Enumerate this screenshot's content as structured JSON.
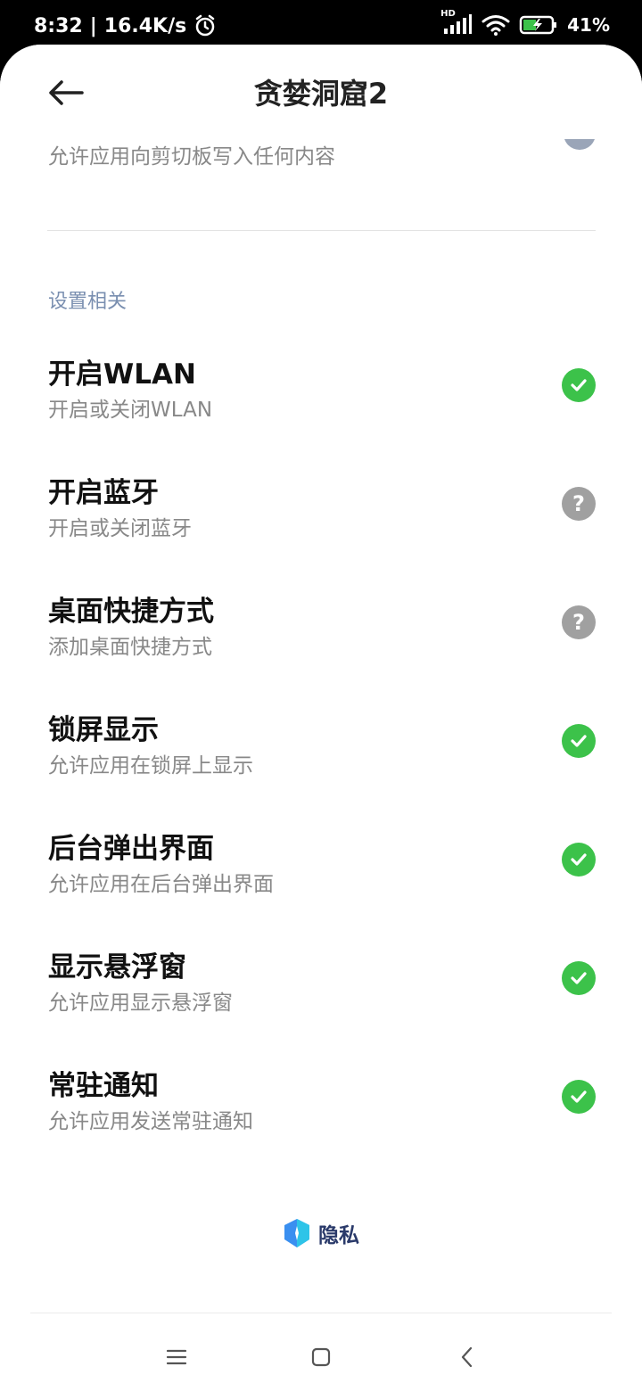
{
  "status_bar": {
    "time": "8:32",
    "separator": "|",
    "net_speed": "16.4K/s",
    "network_badge": "HD",
    "battery": "41%",
    "icons": [
      "alarm-icon",
      "signal-icon",
      "wifi-icon",
      "battery-charging-icon"
    ]
  },
  "header": {
    "title": "贪婪洞窟2",
    "back_icon": "arrow-left-icon"
  },
  "partial_row": {
    "subtitle": "允许应用向剪切板写入任何内容"
  },
  "section": {
    "title": "设置相关"
  },
  "permissions": [
    {
      "title": "开启WLAN",
      "subtitle": "开启或关闭WLAN",
      "status": "granted"
    },
    {
      "title": "开启蓝牙",
      "subtitle": "开启或关闭蓝牙",
      "status": "ask"
    },
    {
      "title": "桌面快捷方式",
      "subtitle": "添加桌面快捷方式",
      "status": "ask"
    },
    {
      "title": "锁屏显示",
      "subtitle": "允许应用在锁屏上显示",
      "status": "granted"
    },
    {
      "title": "后台弹出界面",
      "subtitle": "允许应用在后台弹出界面",
      "status": "granted"
    },
    {
      "title": "显示悬浮窗",
      "subtitle": "允许应用显示悬浮窗",
      "status": "granted"
    },
    {
      "title": "常驻通知",
      "subtitle": "允许应用发送常驻通知",
      "status": "granted"
    }
  ],
  "status_symbols": {
    "ask": "?"
  },
  "footer": {
    "label": "隐私"
  },
  "colors": {
    "granted": "#3cc24a",
    "ask": "#a0a0a0",
    "section_header": "#7a8fb0"
  },
  "nav_bar": {
    "icons": [
      "menu-icon",
      "home-icon",
      "back-icon"
    ]
  }
}
